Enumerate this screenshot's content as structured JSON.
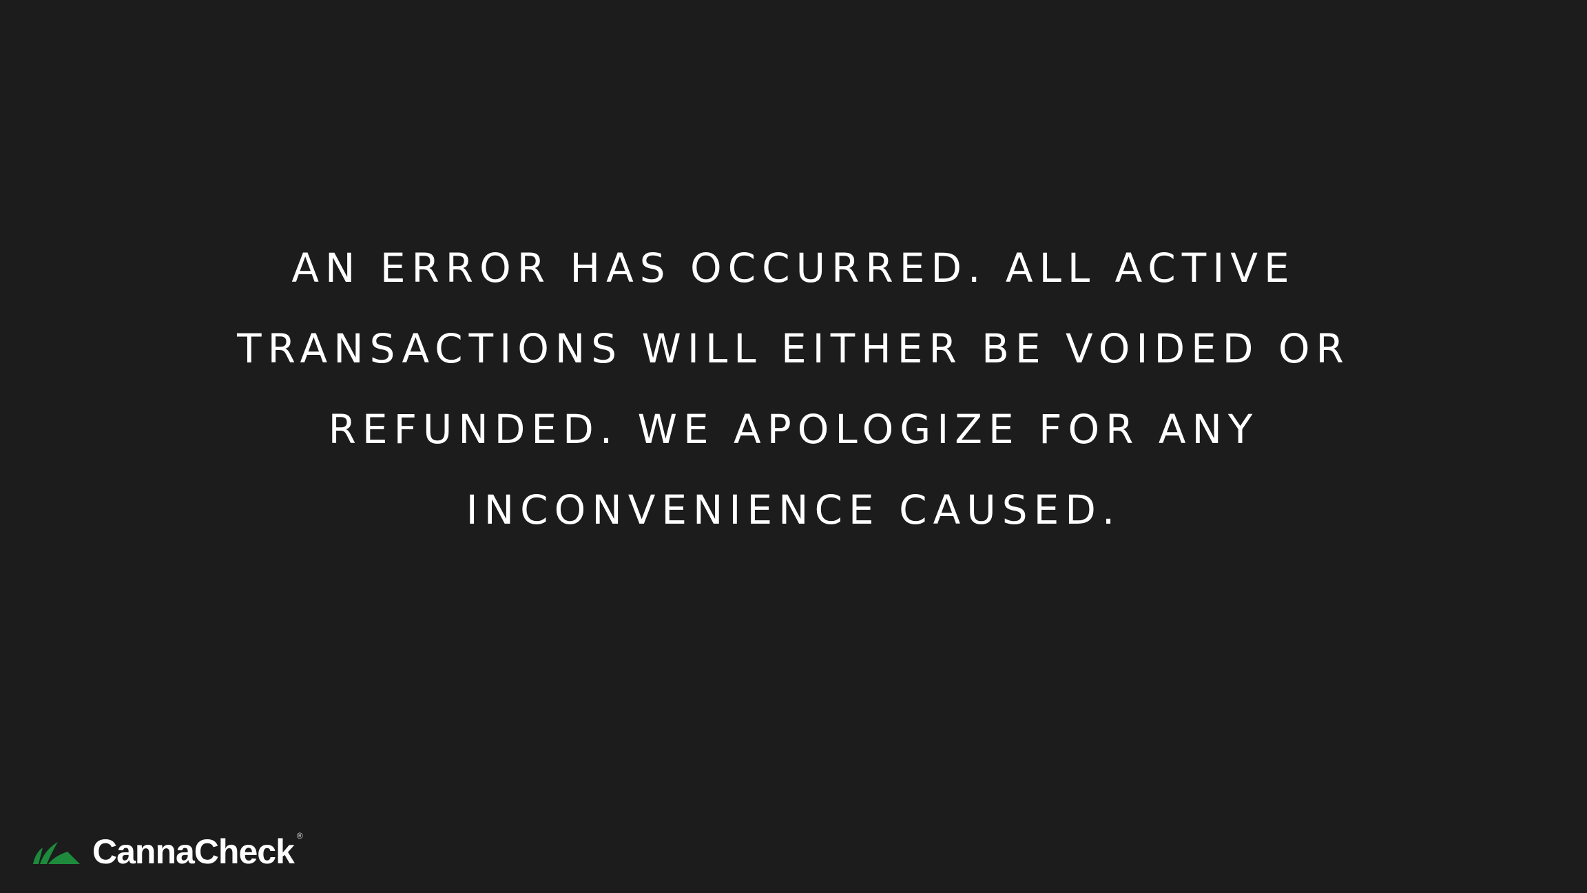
{
  "error": {
    "lines": [
      "AN ERROR HAS OCCURRED. ALL ACTIVE",
      "TRANSACTIONS WILL EITHER BE VOIDED OR",
      "REFUNDED. WE APOLOGIZE FOR ANY",
      "INCONVENIENCE CAUSED."
    ]
  },
  "brand": {
    "name": "CannaCheck",
    "registered_mark": "®",
    "logo_icon": "leaf-icon",
    "logo_color": "#1e8a3c"
  },
  "colors": {
    "background": "#1c1c1c",
    "text": "#ffffff"
  }
}
